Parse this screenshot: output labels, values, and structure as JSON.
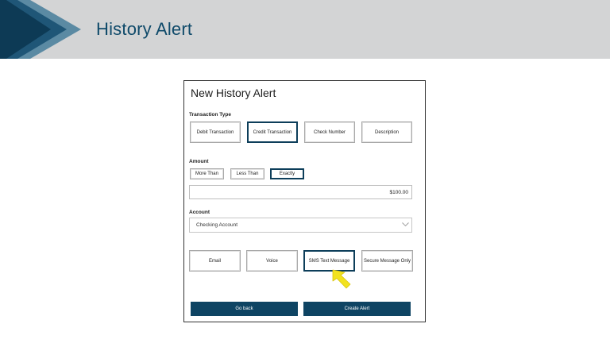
{
  "header": {
    "title": "History Alert"
  },
  "dialog": {
    "title": "New History Alert",
    "transaction_type": {
      "label": "Transaction Type",
      "options": [
        "Debit Transaction",
        "Credit Transaction",
        "Check Number",
        "Description"
      ],
      "selected": "Credit Transaction"
    },
    "amount": {
      "label": "Amount",
      "options": [
        "More Than",
        "Less Than",
        "Exactly"
      ],
      "selected": "Exactly",
      "value": "$100.00"
    },
    "account": {
      "label": "Account",
      "selected_value": "Checking Account"
    },
    "delivery": {
      "options": [
        "Email",
        "Voice",
        "SMS Text Message",
        "Secure Message Only"
      ],
      "selected": "SMS Text Message"
    },
    "buttons": {
      "back": "Go back",
      "create": "Create Alert"
    }
  },
  "colors": {
    "banner_bg": "#d3d4d5",
    "brand_dark": "#0e4463",
    "title_text": "#0f4a6a",
    "cursor": "#f2e21f"
  },
  "icons": {
    "select_chevron": "chevron-down-icon",
    "pointer": "cursor-arrow-icon"
  }
}
